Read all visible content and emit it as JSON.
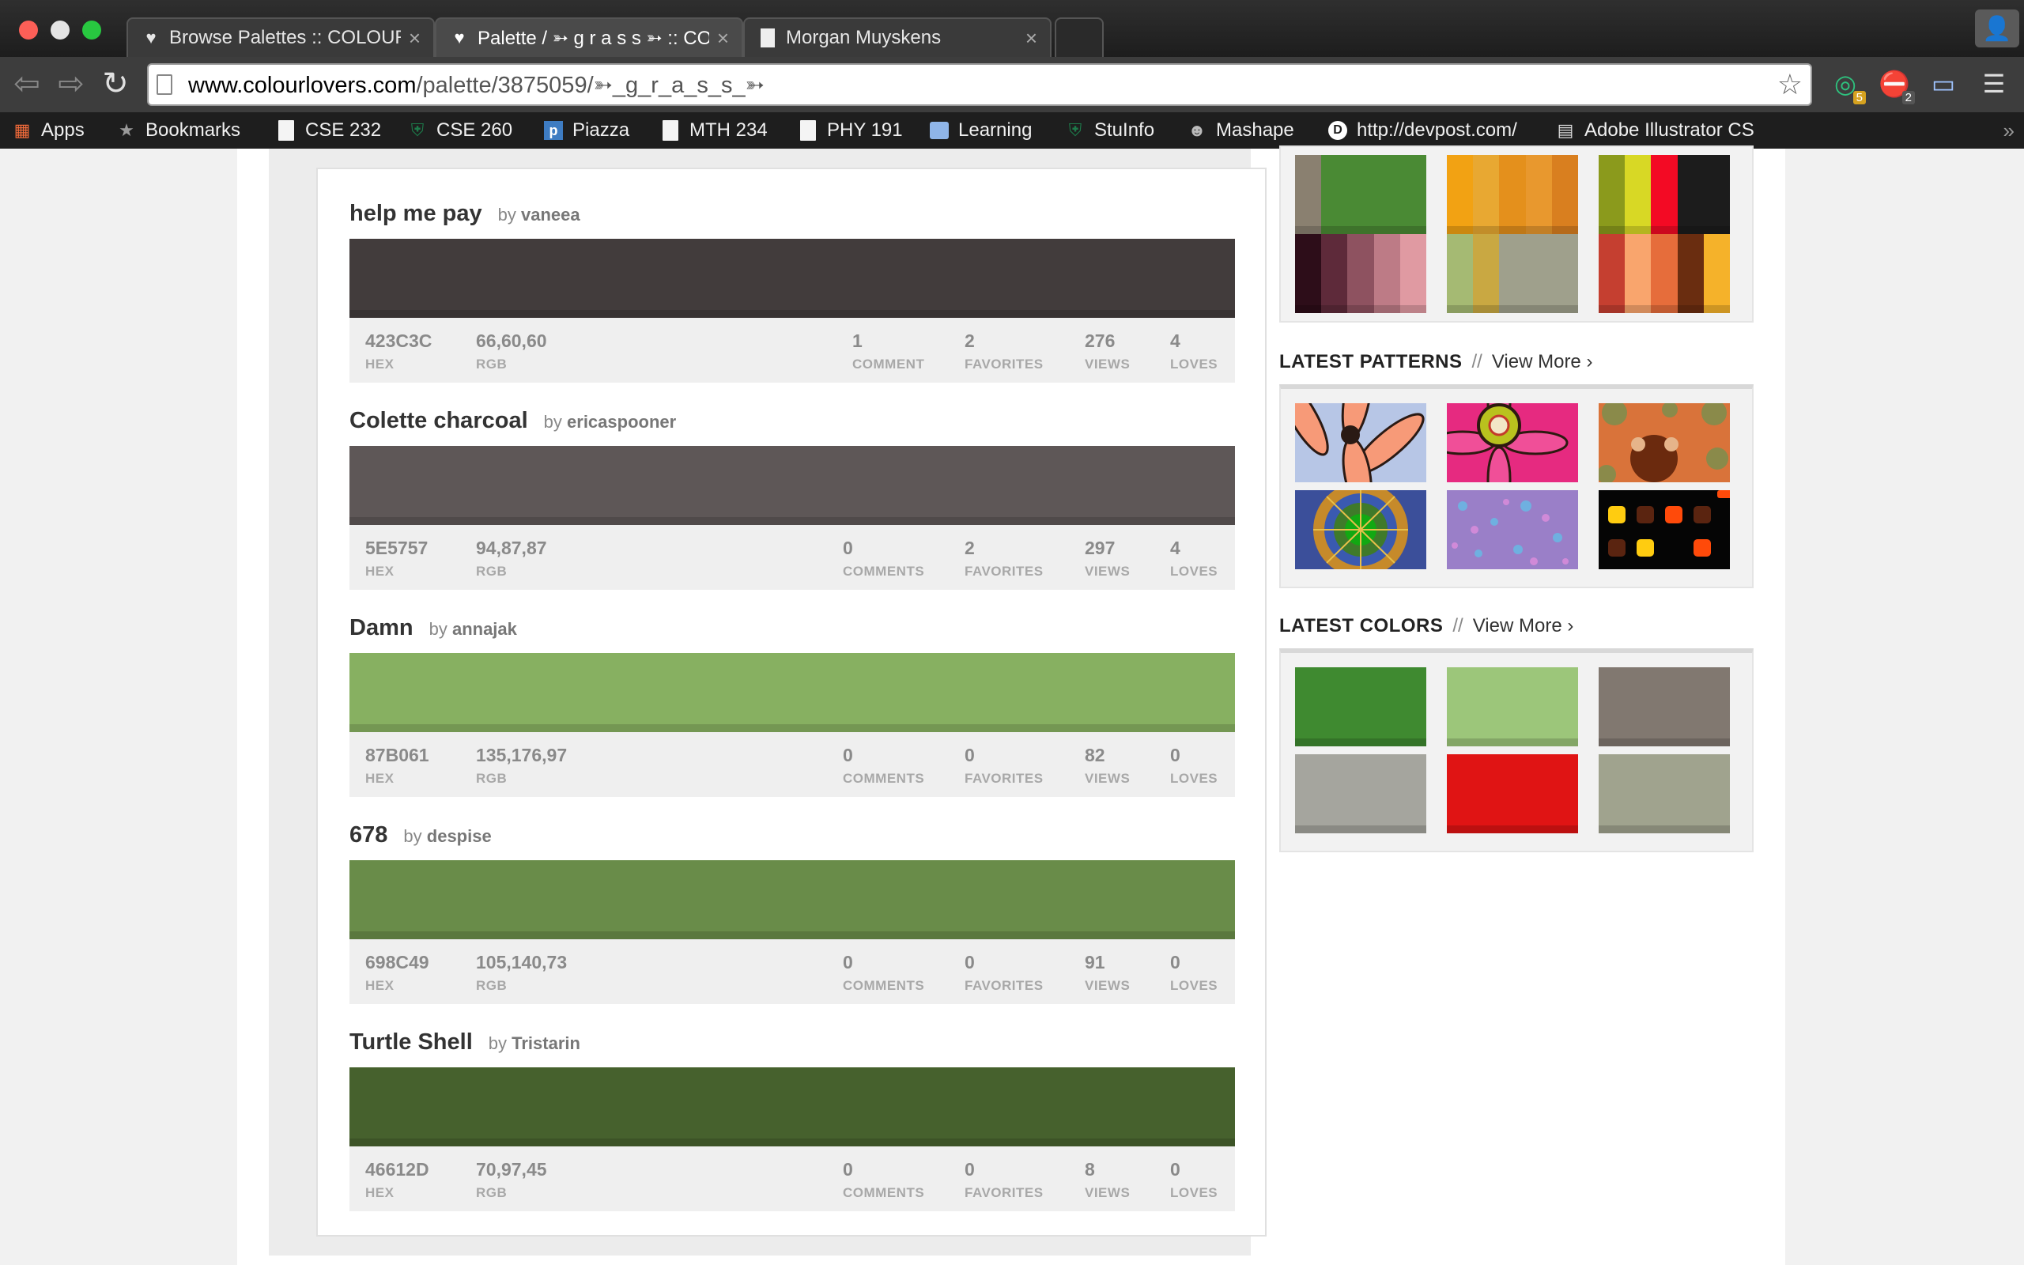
{
  "browser": {
    "tabs": [
      {
        "title": "Browse Palettes :: COLOURLO",
        "active": false,
        "favicon": "heart-icon"
      },
      {
        "title": "Palette / ➳ g r a s s ➳ :: CO",
        "active": true,
        "favicon": "heart-icon"
      },
      {
        "title": "Morgan Muyskens",
        "active": false,
        "favicon": "document-icon"
      }
    ],
    "url_host": "www.colourlovers.com",
    "url_path": "/palette/3875059/➳_g_r_a_s_s_➳",
    "extensions": [
      {
        "name": "grammarly-icon",
        "badge": "5",
        "color": "#2ec27e"
      },
      {
        "name": "adblock-icon",
        "badge": "2",
        "color": "#d9302c"
      },
      {
        "name": "cast-icon",
        "badge": "",
        "color": "#9fc4ff"
      }
    ],
    "bookmarks": [
      {
        "label": "Apps",
        "icon": "apps-grid-icon"
      },
      {
        "label": "Bookmarks",
        "icon": "star-icon"
      },
      {
        "label": "CSE 232",
        "icon": "document-icon"
      },
      {
        "label": "CSE 260",
        "icon": "spartan-icon"
      },
      {
        "label": "Piazza",
        "icon": "piazza-icon"
      },
      {
        "label": "MTH 234",
        "icon": "document-icon"
      },
      {
        "label": "PHY 191",
        "icon": "document-icon"
      },
      {
        "label": "Learning",
        "icon": "folder-icon"
      },
      {
        "label": "StuInfo",
        "icon": "spartan-icon"
      },
      {
        "label": "Mashape",
        "icon": "mashape-icon"
      },
      {
        "label": "http://devpost.com/",
        "icon": "devpost-icon"
      },
      {
        "label": "Adobe Illustrator CS",
        "icon": "illustrator-icon"
      }
    ]
  },
  "palettes": [
    {
      "title": "help me pay",
      "by": "by",
      "author": "vaneea",
      "color": "#423C3C",
      "hex": "423C3C",
      "hex_label": "HEX",
      "rgb": "66,60,60",
      "rgb_label": "RGB",
      "comments": "1",
      "comments_label": "COMMENT",
      "favorites": "2",
      "favorites_label": "FAVORITES",
      "views": "276",
      "views_label": "VIEWS",
      "loves": "4",
      "loves_label": "LOVES"
    },
    {
      "title": "Colette charcoal",
      "by": "by",
      "author": "ericaspooner",
      "color": "#5E5757",
      "hex": "5E5757",
      "hex_label": "HEX",
      "rgb": "94,87,87",
      "rgb_label": "RGB",
      "comments": "0",
      "comments_label": "COMMENTS",
      "favorites": "2",
      "favorites_label": "FAVORITES",
      "views": "297",
      "views_label": "VIEWS",
      "loves": "4",
      "loves_label": "LOVES"
    },
    {
      "title": "Damn",
      "by": "by",
      "author": "annajak",
      "color": "#87B061",
      "hex": "87B061",
      "hex_label": "HEX",
      "rgb": "135,176,97",
      "rgb_label": "RGB",
      "comments": "0",
      "comments_label": "COMMENTS",
      "favorites": "0",
      "favorites_label": "FAVORITES",
      "views": "82",
      "views_label": "VIEWS",
      "loves": "0",
      "loves_label": "LOVES"
    },
    {
      "title": "678",
      "by": "by",
      "author": "despise",
      "color": "#698C49",
      "hex": "698C49",
      "hex_label": "HEX",
      "rgb": "105,140,73",
      "rgb_label": "RGB",
      "comments": "0",
      "comments_label": "COMMENTS",
      "favorites": "0",
      "favorites_label": "FAVORITES",
      "views": "91",
      "views_label": "VIEWS",
      "loves": "0",
      "loves_label": "LOVES"
    },
    {
      "title": "Turtle Shell",
      "by": "by",
      "author": "Tristarin",
      "color": "#46612D",
      "hex": "46612D",
      "hex_label": "HEX",
      "rgb": "70,97,45",
      "rgb_label": "RGB",
      "comments": "0",
      "comments_label": "COMMENTS",
      "favorites": "0",
      "favorites_label": "FAVORITES",
      "views": "8",
      "views_label": "VIEWS",
      "loves": "0",
      "loves_label": "LOVES"
    }
  ],
  "sidebar": {
    "palette_tiles": [
      [
        "#8a8070",
        "#4a8a34",
        "#4a8a34",
        "#4a8a34",
        "#4a8a34"
      ],
      [
        "#f2a213",
        "#e8a832",
        "#e4901c",
        "#e8982e",
        "#d97f1f"
      ],
      [
        "#8b9a1c",
        "#d8d825",
        "#f30a24",
        "#1c1c1c",
        "#1c1c1c"
      ],
      [
        "#2d0d19",
        "#5e2a3a",
        "#8e5260",
        "#bd7b86",
        "#e09aa2"
      ],
      [
        "#a5ba73",
        "#c9a842",
        "#9fa08c",
        "#9fa08c",
        "#9fa08c"
      ],
      [
        "#c53f30",
        "#f9a56d",
        "#e66d3b",
        "#6a2d10",
        "#f5b22a"
      ]
    ],
    "patterns": {
      "title": "LATEST PATTERNS",
      "sep": "//",
      "more": "View More ›",
      "tiles": [
        "flower-salmon-pattern",
        "flower-pink-pattern",
        "dots-orange-pattern",
        "mandala-green-pattern",
        "speckle-purple-pattern",
        "squares-black-pattern"
      ]
    },
    "colors": {
      "title": "LATEST COLORS",
      "sep": "//",
      "more": "View More ›",
      "tiles": [
        "#3f8a30",
        "#9cc67a",
        "#817870",
        "#a5a59e",
        "#e01414",
        "#a0a38e"
      ]
    }
  }
}
